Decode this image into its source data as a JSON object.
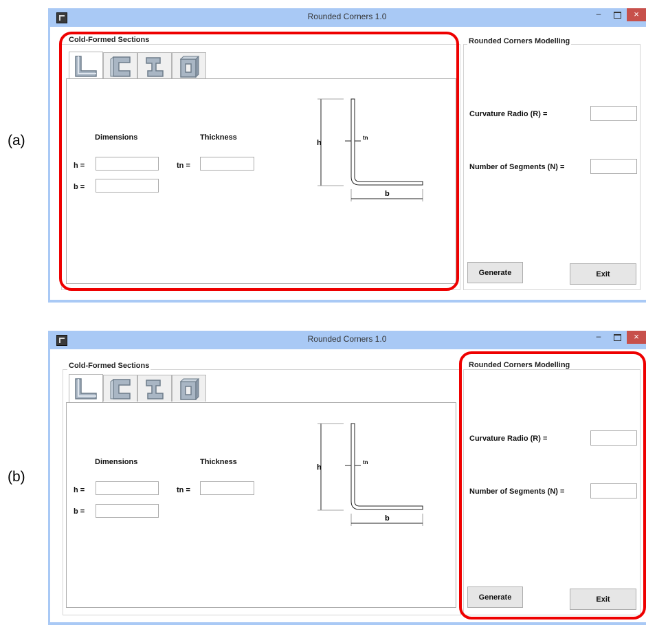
{
  "panels": [
    {
      "label": "(a)",
      "highlight": "cold-formed-sections",
      "window": {
        "title": "Rounded Corners 1.0",
        "minimize": "–",
        "close": "×"
      },
      "sections": {
        "title": "Cold-Formed Sections",
        "tabs": [
          "L",
          "C",
          "I",
          "O"
        ],
        "active_tab": "L",
        "dimensions_header": "Dimensions",
        "thickness_header": "Thickness",
        "h_label": "h =",
        "b_label": "b =",
        "tn_label": "tn =",
        "h_value": "",
        "b_value": "",
        "tn_value": "",
        "diagram": {
          "h": "h",
          "b": "b",
          "tn": "tn"
        }
      },
      "modelling": {
        "title": "Rounded Corners Modelling",
        "radius_label": "Curvature Radio (R)  =",
        "segments_label": "Number of Segments (N) =",
        "radius_value": "",
        "segments_value": "",
        "generate": "Generate",
        "exit": "Exit"
      }
    },
    {
      "label": "(b)",
      "highlight": "rounded-corners-modelling",
      "window": {
        "title": "Rounded Corners 1.0",
        "minimize": "–",
        "close": "×"
      },
      "sections": {
        "title": "Cold-Formed Sections",
        "tabs": [
          "L",
          "C",
          "I",
          "O"
        ],
        "active_tab": "L",
        "dimensions_header": "Dimensions",
        "thickness_header": "Thickness",
        "h_label": "h =",
        "b_label": "b =",
        "tn_label": "tn =",
        "h_value": "",
        "b_value": "",
        "tn_value": "",
        "diagram": {
          "h": "h",
          "b": "b",
          "tn": "tn"
        }
      },
      "modelling": {
        "title": "Rounded Corners Modelling",
        "radius_label": "Curvature Radio (R)  =",
        "segments_label": "Number of Segments (N) =",
        "radius_value": "",
        "segments_value": "",
        "generate": "Generate",
        "exit": "Exit"
      }
    }
  ],
  "colors": {
    "titlebar": "#a9c9f5",
    "close_button": "#c7504b",
    "highlight": "#ee0000",
    "profile_fill": "#a9b6c4",
    "profile_edge": "#6d7c8a"
  }
}
